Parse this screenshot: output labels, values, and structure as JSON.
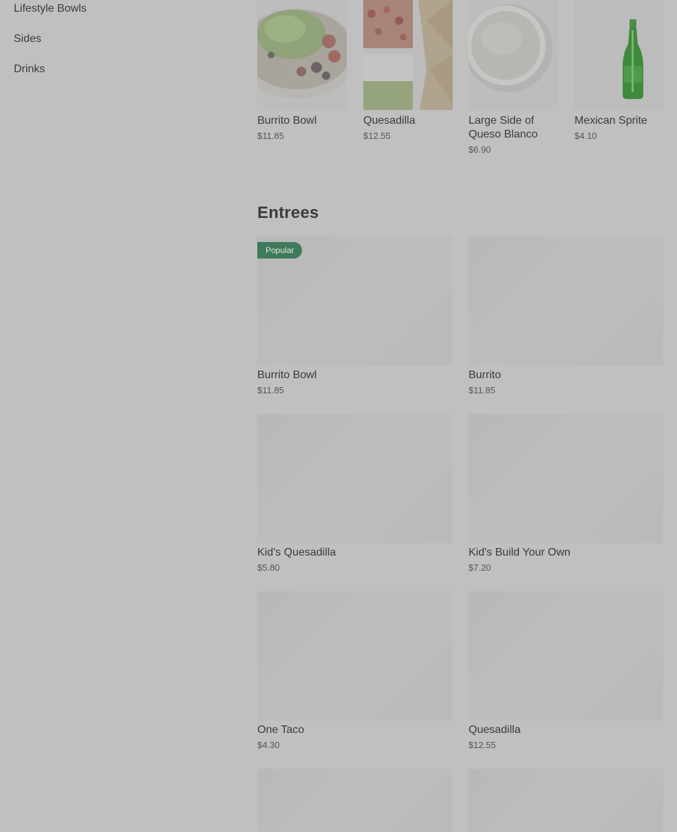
{
  "sidebar": {
    "items": [
      {
        "label": "Lifestyle Bowls"
      },
      {
        "label": "Sides"
      },
      {
        "label": "Drinks"
      }
    ]
  },
  "featured": [
    {
      "name": "Burrito Bowl",
      "price": "$11.85",
      "image": "burrito-bowl-photo"
    },
    {
      "name": "Quesadilla",
      "price": "$12.55",
      "image": "quesadilla-photo"
    },
    {
      "name": "Large Side of Queso Blanco",
      "price": "$6.90",
      "image": "queso-blanco-photo"
    },
    {
      "name": "Mexican Sprite",
      "price": "$4.10",
      "image": "sprite-bottle-photo"
    }
  ],
  "entrees": {
    "title": "Entrees",
    "items": [
      {
        "name": "Burrito Bowl",
        "price": "$11.85",
        "badge": "Popular"
      },
      {
        "name": "Burrito",
        "price": "$11.85"
      },
      {
        "name": "Kid's Quesadilla",
        "price": "$5.80"
      },
      {
        "name": "Kid's Build Your Own",
        "price": "$7.20"
      },
      {
        "name": "One Taco",
        "price": "$4.30"
      },
      {
        "name": "Quesadilla",
        "price": "$12.55"
      },
      {
        "name": "",
        "price": ""
      },
      {
        "name": "",
        "price": ""
      }
    ]
  },
  "colors": {
    "overlay": "#c0c0c0",
    "badge": "#3f7a5c"
  }
}
